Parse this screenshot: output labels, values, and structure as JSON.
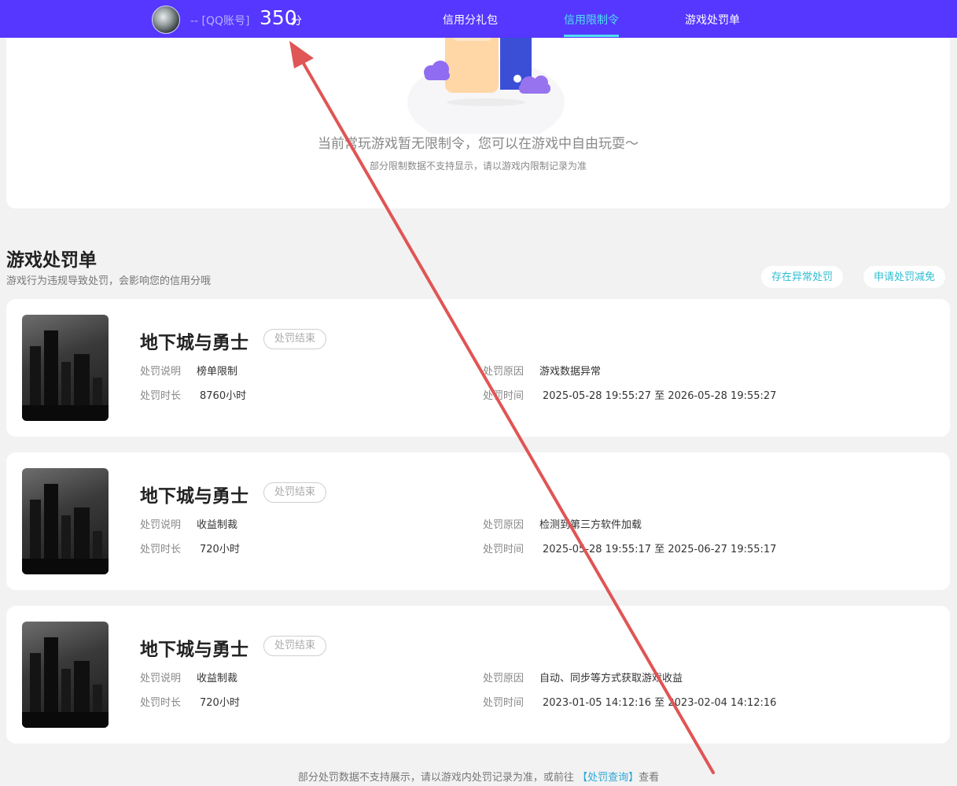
{
  "header": {
    "account_label": "-- [QQ账号]",
    "score": "350",
    "score_unit": "分",
    "nav": [
      "信用分礼包",
      "信用限制令",
      "游戏处罚单"
    ],
    "active_nav": "信用限制令"
  },
  "restriction": {
    "empty_title": "当前常玩游戏暂无限制令，您可以在游戏中自由玩耍～",
    "empty_note": "部分限制数据不支持显示，请以游戏内限制记录为准"
  },
  "penalty_section": {
    "title": "游戏处罚单",
    "subtitle": "游戏行为违规导致处罚，会影响您的信用分哦",
    "btn_abnormal": "存在异常处罚",
    "btn_reduce": "申请处罚减免",
    "labels": {
      "desc": "处罚说明",
      "duration": "处罚时长",
      "reason": "处罚原因",
      "time": "处罚时间",
      "to": "至"
    },
    "items": [
      {
        "game": "地下城与勇士",
        "status": "处罚结束",
        "desc": "榜单限制",
        "duration": "8760小时",
        "reason": "游戏数据异常",
        "start": "2025-05-28 19:55:27",
        "end": "2026-05-28 19:55:27"
      },
      {
        "game": "地下城与勇士",
        "status": "处罚结束",
        "desc": "收益制裁",
        "duration": "720小时",
        "reason": "检测到第三方软件加载",
        "start": "2025-05-28 19:55:17",
        "end": "2025-06-27 19:55:17"
      },
      {
        "game": "地下城与勇士",
        "status": "处罚结束",
        "desc": "收益制裁",
        "duration": "720小时",
        "reason": "自动、同步等方式获取游戏收益",
        "start": "2023-01-05 14:12:16",
        "end": "2023-02-04 14:12:16"
      }
    ]
  },
  "footer": {
    "prefix": "部分处罚数据不支持展示，请以游戏内处罚记录为准，或前往",
    "link": "【处罚查询】",
    "suffix": "查看"
  },
  "colors": {
    "header_bg": "#5537ff",
    "nav_active": "#4fe0ee",
    "link": "#2fa7d6",
    "annotation_arrow": "#e05555"
  }
}
